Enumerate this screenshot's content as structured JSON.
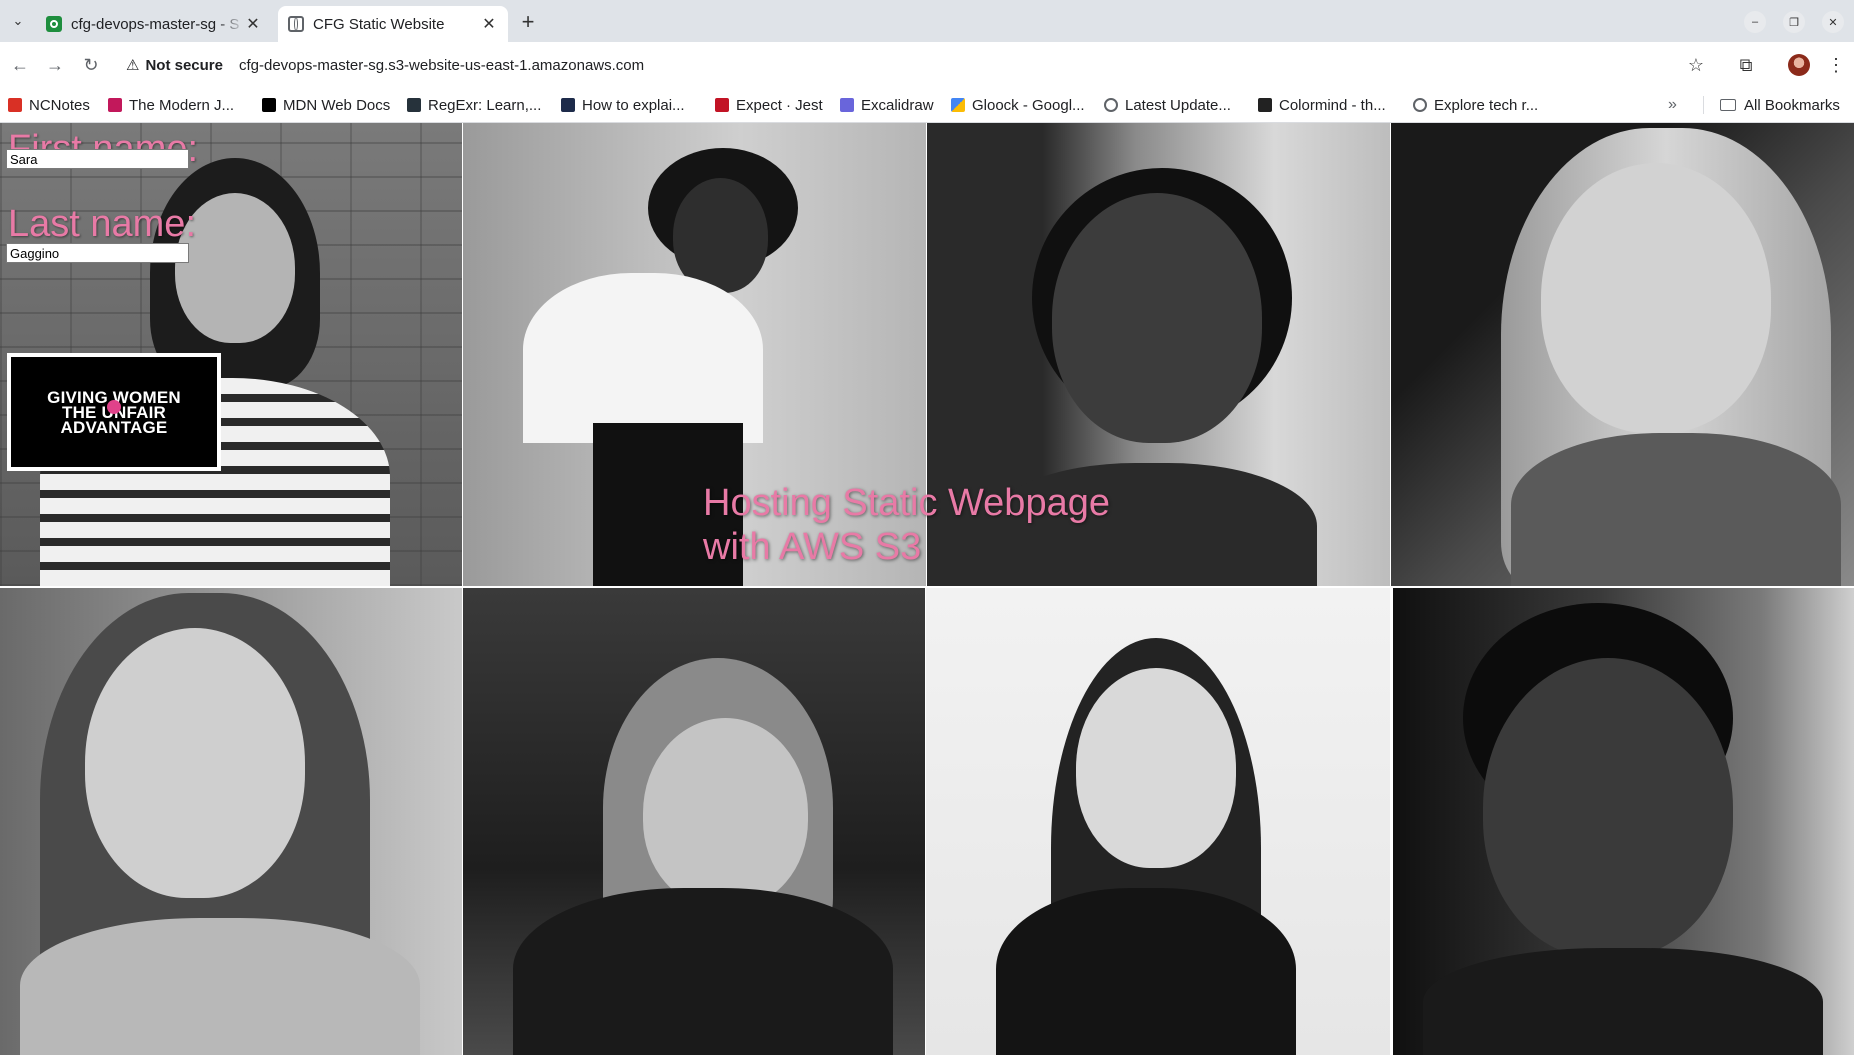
{
  "browser": {
    "tabs": [
      {
        "title": "cfg-devops-master-sg - S",
        "active": false
      },
      {
        "title": "CFG Static Website",
        "active": true
      }
    ],
    "address": {
      "security_label": "Not secure",
      "url": "cfg-devops-master-sg.s3-website-us-east-1.amazonaws.com"
    },
    "bookmarks": [
      {
        "label": "NCNotes",
        "icon": "ncnotes-icon",
        "color": "#d93025"
      },
      {
        "label": "The Modern J...",
        "icon": "modern-js-icon",
        "color": "#c2185b"
      },
      {
        "label": "MDN Web Docs",
        "icon": "mdn-icon",
        "color": "#000000"
      },
      {
        "label": "RegExr: Learn,...",
        "icon": "regexr-icon",
        "color": "#26323b"
      },
      {
        "label": "How to explai...",
        "icon": "how-to-icon",
        "color": "#1d2b4a"
      },
      {
        "label": "Expect · Jest",
        "icon": "jest-icon",
        "color": "#c21325"
      },
      {
        "label": "Excalidraw",
        "icon": "excalidraw-icon",
        "color": "#6965db"
      },
      {
        "label": "Gloock - Googl...",
        "icon": "google-fonts-icon",
        "color": "#4285f4"
      },
      {
        "label": "Latest Update...",
        "icon": "globe-icon",
        "color": "#5f6368"
      },
      {
        "label": "Colormind - th...",
        "icon": "colormind-icon",
        "color": "#222222"
      },
      {
        "label": "Explore tech r...",
        "icon": "globe-icon",
        "color": "#5f6368"
      }
    ],
    "all_bookmarks_label": "All Bookmarks"
  },
  "page": {
    "first_name_label": "First name:",
    "first_name_value": "Sara",
    "last_name_label": "Last name:",
    "last_name_value": "Gaggino",
    "logo_lines": [
      "GIVING WOMEN",
      "THE UNFAIR",
      "ADVANTAGE"
    ],
    "headline_line1": "Hosting Static Webpage",
    "headline_line2": "with AWS S3",
    "accent_color": "#e87aa6"
  }
}
